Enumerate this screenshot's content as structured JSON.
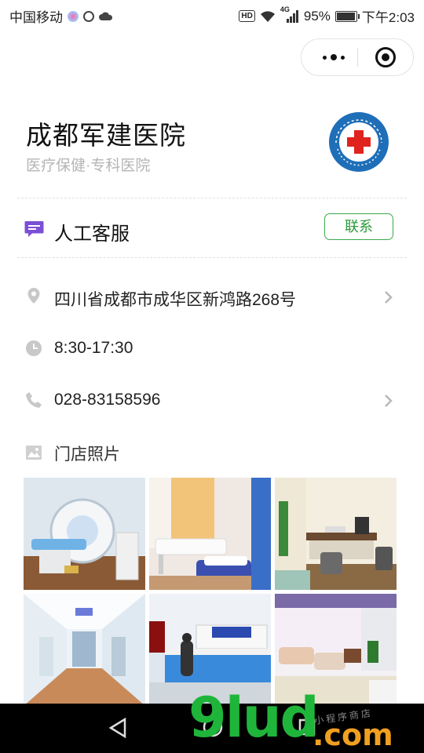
{
  "status_bar": {
    "carrier": "中国移动",
    "hd": "HD",
    "network": "4G",
    "battery": "95%",
    "battery_level": 0.95,
    "time": "下午2:03"
  },
  "store": {
    "name": "成都军建医院",
    "category": "医疗保健·专科医院",
    "logo_icon": "hospital-red-cross-logo"
  },
  "service": {
    "label": "人工客服",
    "button_label": "联系",
    "icon": "chat-bubble-icon"
  },
  "info_rows": [
    {
      "icon": "location-pin-icon",
      "text": "四川省成都市成华区新鸿路268号",
      "has_arrow": true
    },
    {
      "icon": "clock-icon",
      "text": "8:30-17:30",
      "has_arrow": false
    },
    {
      "icon": "phone-icon",
      "text": "028-83158596",
      "has_arrow": true
    }
  ],
  "photos": {
    "label": "门店照片",
    "icon": "image-icon"
  },
  "watermark": {
    "main": "9lud",
    "suffix": ".com",
    "small": "小程序商店"
  },
  "colors": {
    "accent_green": "#2a9a3a",
    "service_purple": "#7b4fd6",
    "logo_blue": "#1f6fb8",
    "logo_red": "#e0231f"
  }
}
